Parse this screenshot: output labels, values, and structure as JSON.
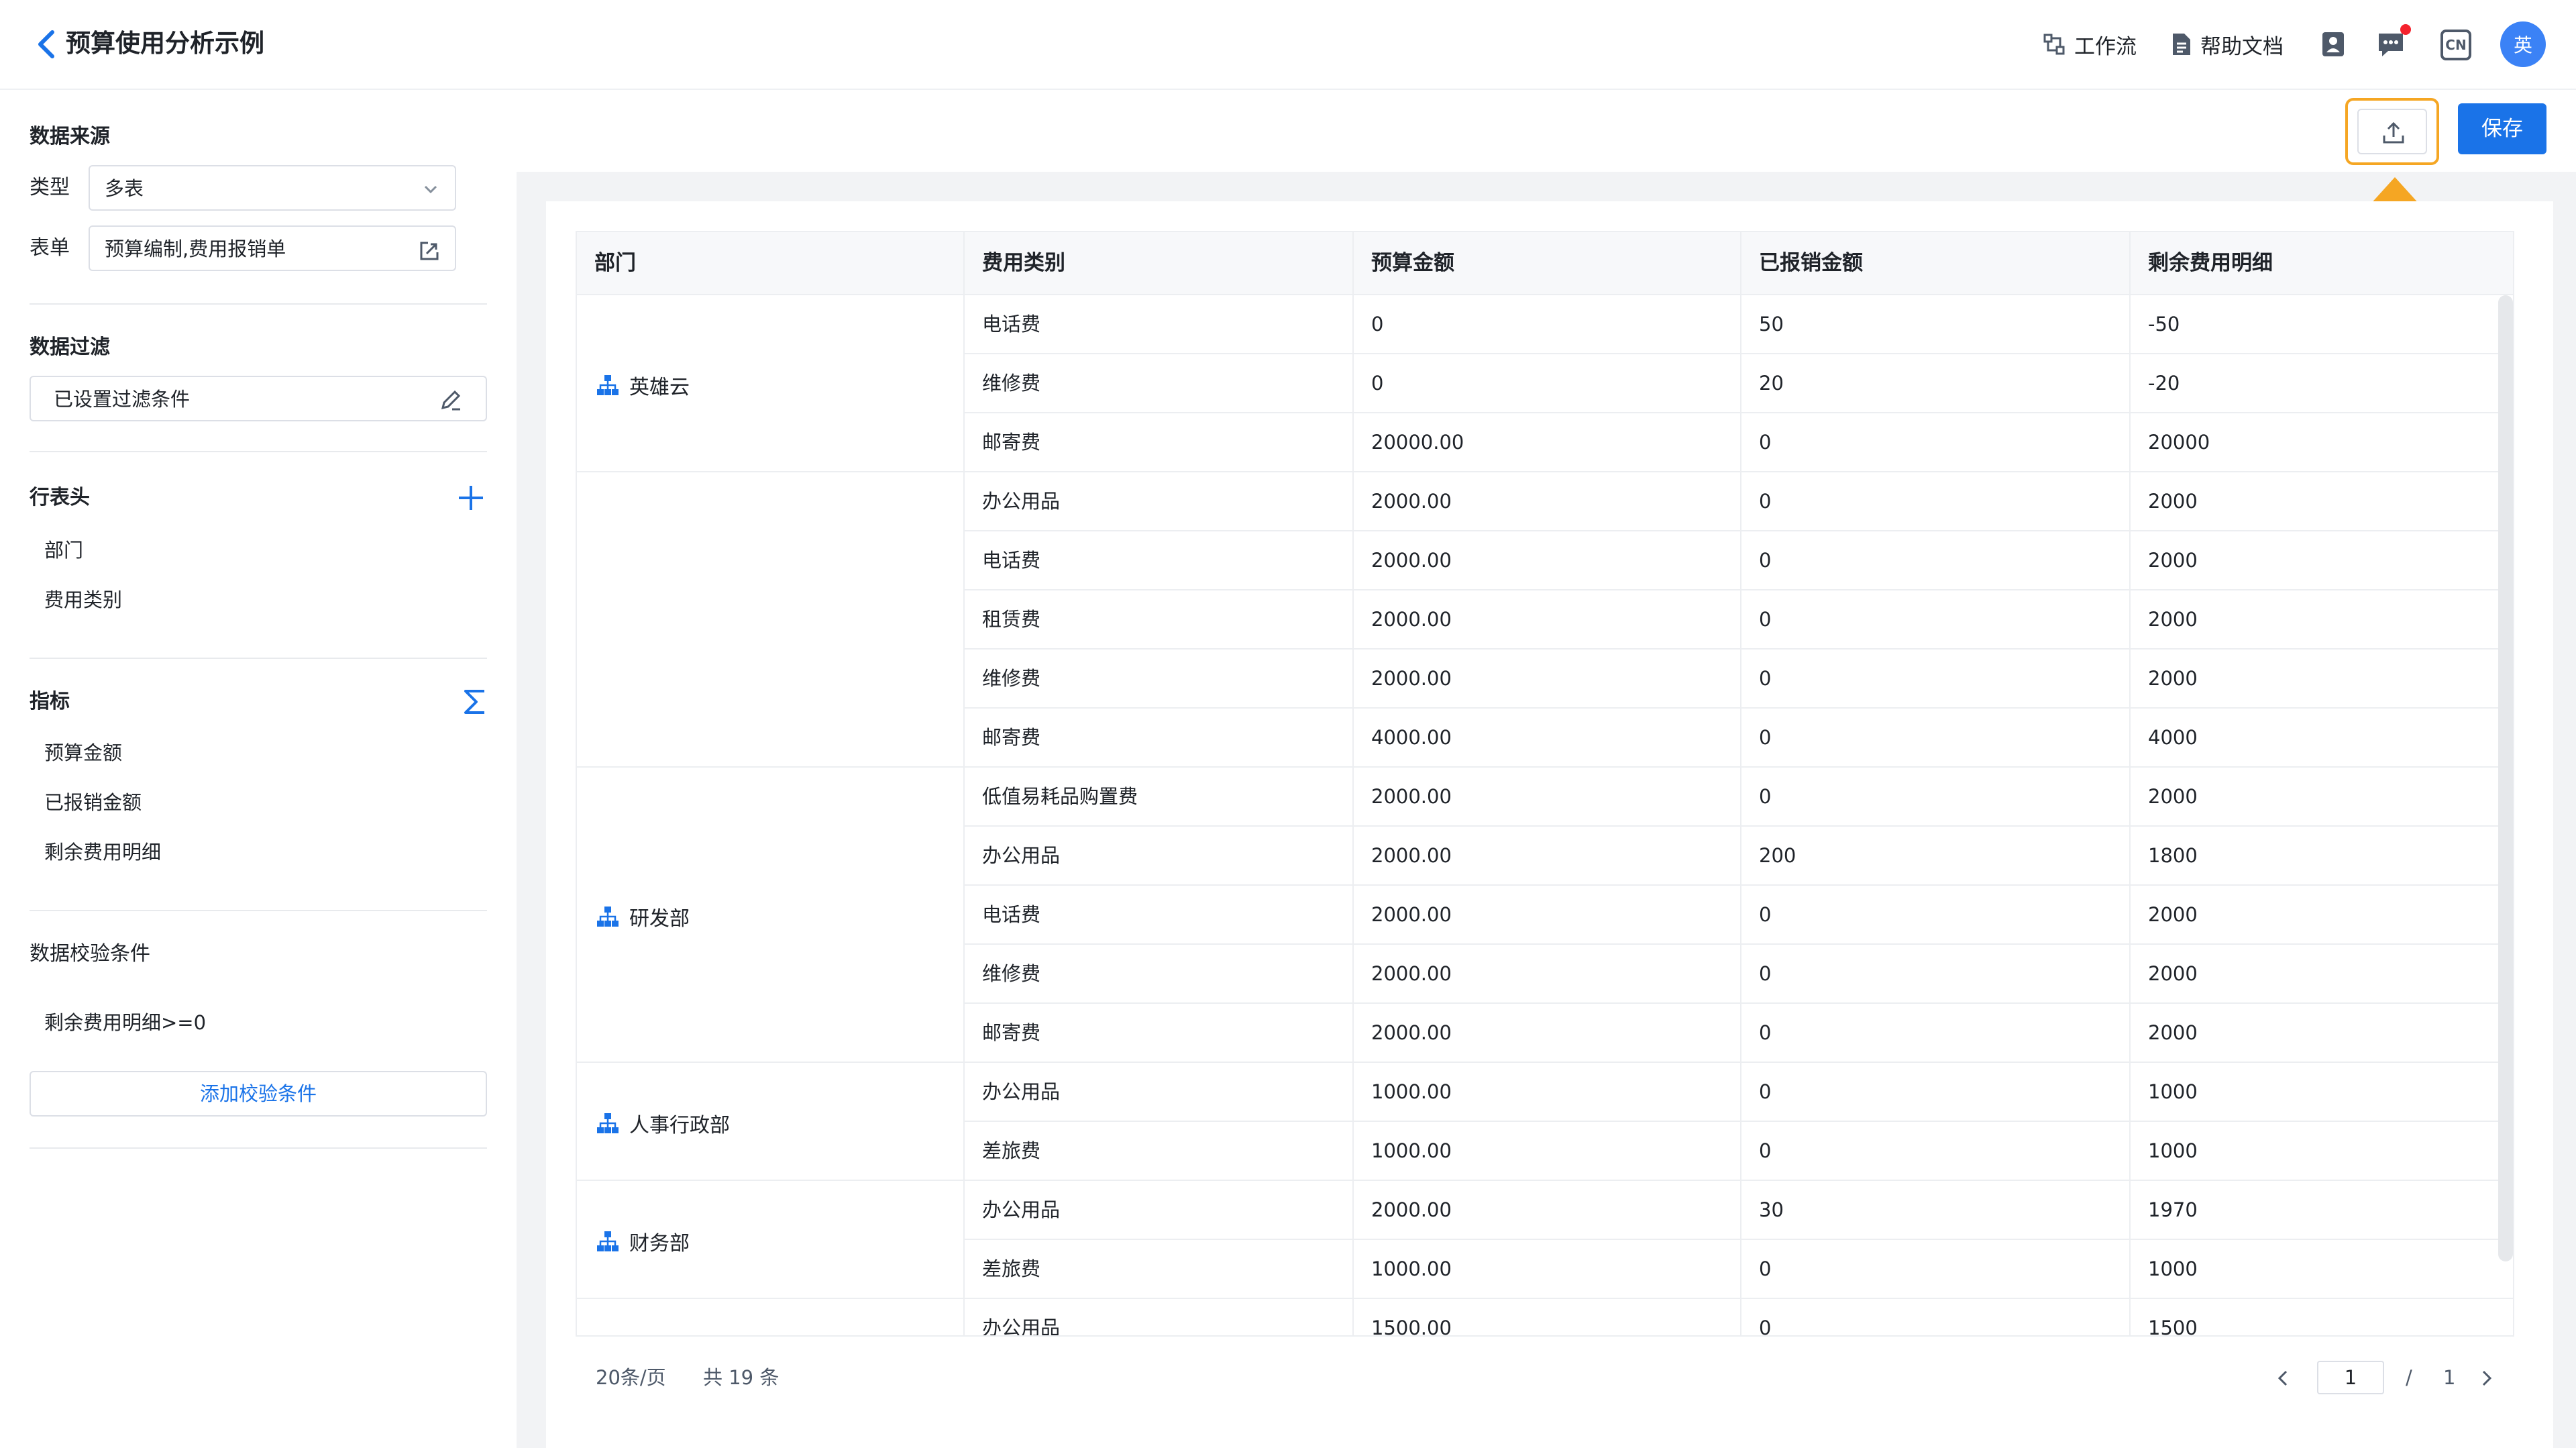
{
  "header": {
    "title": "预算使用分析示例",
    "workflow_label": "工作流",
    "help_label": "帮助文档",
    "lang_label": "CN",
    "avatar_text": "英"
  },
  "toolbar": {
    "save_label": "保存",
    "highlight_color": "#f5a623",
    "primary_color": "#1a73e8"
  },
  "sidebar": {
    "data_source_title": "数据来源",
    "type_label": "类型",
    "type_value": "多表",
    "form_label": "表单",
    "form_value": "预算编制,费用报销单",
    "filter_title": "数据过滤",
    "filter_value": "已设置过滤条件",
    "row_header_title": "行表头",
    "row_headers": [
      "部门",
      "费用类别"
    ],
    "metrics_title": "指标",
    "metrics": [
      "预算金额",
      "已报销金额",
      "剩余费用明细"
    ],
    "validation_title": "数据校验条件",
    "validation_rule": "剩余费用明细>=0",
    "add_validation_label": "添加校验条件"
  },
  "table": {
    "columns": [
      "部门",
      "费用类别",
      "预算金额",
      "已报销金额",
      "剩余费用明细"
    ],
    "departments": [
      "英雄云",
      "",
      "研发部",
      "人事行政部",
      "财务部",
      ""
    ],
    "rows": [
      [
        "电话费",
        "0",
        "50",
        "-50"
      ],
      [
        "维修费",
        "0",
        "20",
        "-20"
      ],
      [
        "邮寄费",
        "20000.00",
        "0",
        "20000"
      ],
      [
        "办公用品",
        "2000.00",
        "0",
        "2000"
      ],
      [
        "电话费",
        "2000.00",
        "0",
        "2000"
      ],
      [
        "租赁费",
        "2000.00",
        "0",
        "2000"
      ],
      [
        "维修费",
        "2000.00",
        "0",
        "2000"
      ],
      [
        "邮寄费",
        "4000.00",
        "0",
        "4000"
      ],
      [
        "低值易耗品购置费",
        "2000.00",
        "0",
        "2000"
      ],
      [
        "办公用品",
        "2000.00",
        "200",
        "1800"
      ],
      [
        "电话费",
        "2000.00",
        "0",
        "2000"
      ],
      [
        "维修费",
        "2000.00",
        "0",
        "2000"
      ],
      [
        "邮寄费",
        "2000.00",
        "0",
        "2000"
      ],
      [
        "办公用品",
        "1000.00",
        "0",
        "1000"
      ],
      [
        "差旅费",
        "1000.00",
        "0",
        "1000"
      ],
      [
        "办公用品",
        "2000.00",
        "30",
        "1970"
      ],
      [
        "差旅费",
        "1000.00",
        "0",
        "1000"
      ],
      [
        "办公用品",
        "1500.00",
        "0",
        "1500"
      ]
    ]
  },
  "pagination": {
    "page_size": "20条/页",
    "total": "共 19 条",
    "current_page": "1",
    "separator": "/",
    "total_pages": "1"
  }
}
